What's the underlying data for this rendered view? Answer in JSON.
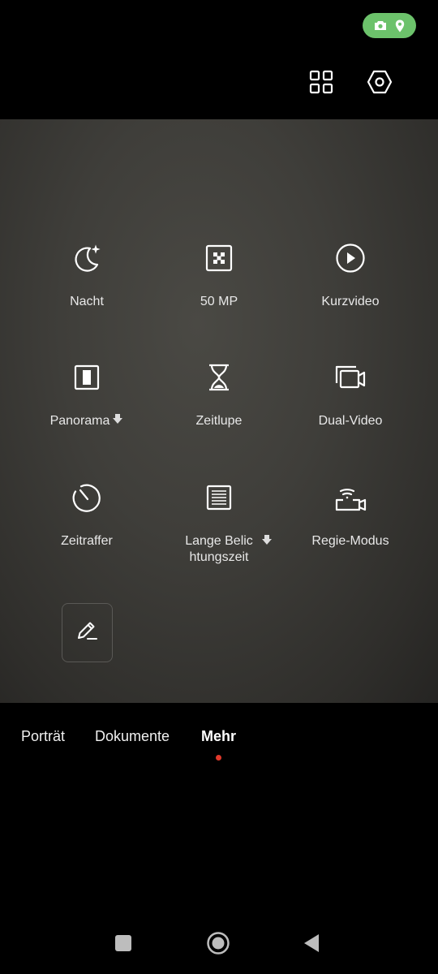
{
  "status": {
    "camera_icon": "camera-icon",
    "location_icon": "location-icon",
    "color": "#6cc26b"
  },
  "toolbar": {
    "grid_icon": "grid-icon",
    "settings_icon": "settings-hexagon-icon"
  },
  "modes": [
    {
      "label": "Nacht",
      "icon": "night-moon-icon"
    },
    {
      "label": "50 MP",
      "icon": "50mp-icon"
    },
    {
      "label": "Kurzvideo",
      "icon": "play-circle-icon"
    },
    {
      "label": "Panorama",
      "icon": "panorama-icon",
      "download": true
    },
    {
      "label": "Zeitlupe",
      "icon": "hourglass-icon"
    },
    {
      "label": "Dual-Video",
      "icon": "dual-video-icon"
    },
    {
      "label": "Zeitraffer",
      "icon": "timelapse-icon"
    },
    {
      "label_line1": "Lange Belic",
      "label_line2": "htungszeit",
      "icon": "long-exposure-icon",
      "download": true
    },
    {
      "label": "Regie-Modus",
      "icon": "director-mode-icon"
    }
  ],
  "edit": {
    "icon": "pencil-icon"
  },
  "tabs": [
    {
      "label": "Porträt"
    },
    {
      "label": "Dokumente"
    },
    {
      "label": "Mehr",
      "active": true
    }
  ],
  "accent": "#e0392b"
}
